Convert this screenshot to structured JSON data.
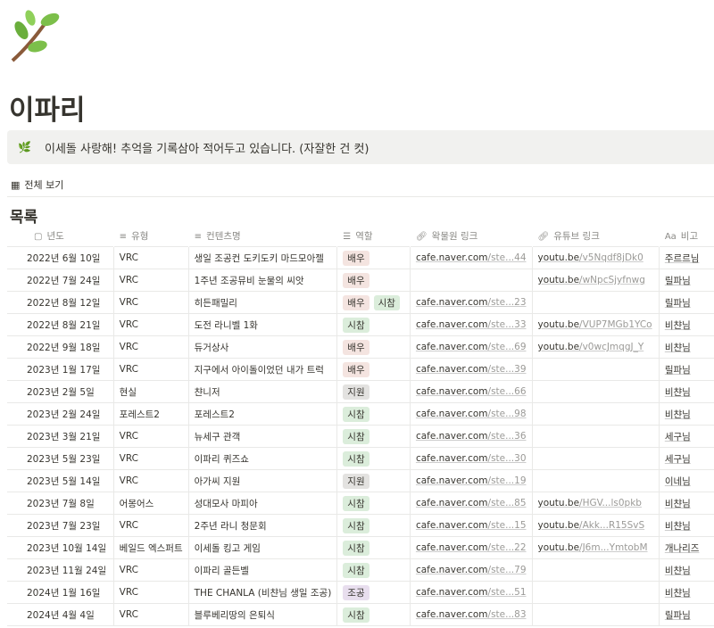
{
  "page": {
    "title": "이파리",
    "callout_icon": "leaf-icon",
    "callout": "이세돌 사랑해! 추억을 기록삼아 적어두고 있습니다. (자잘한 건 컷)",
    "view_label": "전체 보기",
    "section_title": "목록"
  },
  "columns": [
    "년도",
    "유형",
    "컨텐츠명",
    "역할",
    "왁물원 링크",
    "유튜브 링크",
    "비고"
  ],
  "tag_colors": {
    "배우": "#f4e4e0",
    "시참": "#dbeddb",
    "지원": "#e3e2e0",
    "조공": "#e8deee"
  },
  "rows": [
    {
      "date": "2022년 6월 10일",
      "type": "VRC",
      "name": "생일 조공컨 도키도키 마드모아젤",
      "roles": [
        "배우"
      ],
      "cafe": "cafe.naver.com",
      "cafe_rest": "/ste...44",
      "yt": "youtu.be",
      "yt_rest": "/v5Nqdf8jDk0",
      "note": "주르르님"
    },
    {
      "date": "2022년 7월 24일",
      "type": "VRC",
      "name": "1주년 조공뮤비 눈물의 씨앗",
      "roles": [
        "배우"
      ],
      "cafe": "",
      "cafe_rest": "",
      "yt": "youtu.be",
      "yt_rest": "/wNpcSjyfnwg",
      "note": "릴파님"
    },
    {
      "date": "2022년 8월 12일",
      "type": "VRC",
      "name": "히든패밀리",
      "roles": [
        "배우",
        "시참"
      ],
      "cafe": "cafe.naver.com",
      "cafe_rest": "/ste...23",
      "yt": "",
      "yt_rest": "",
      "note": "릴파님"
    },
    {
      "date": "2022년 8월 21일",
      "type": "VRC",
      "name": "도전 라니벨 1화",
      "roles": [
        "시참"
      ],
      "cafe": "cafe.naver.com",
      "cafe_rest": "/ste...33",
      "yt": "youtu.be",
      "yt_rest": "/VUP7MGb1YCo",
      "note": "비챤님"
    },
    {
      "date": "2022년 9월 18일",
      "type": "VRC",
      "name": "듀거상사",
      "roles": [
        "배우"
      ],
      "cafe": "cafe.naver.com",
      "cafe_rest": "/ste...69",
      "yt": "youtu.be",
      "yt_rest": "/v0wcJmqgJ_Y",
      "note": "비챤님"
    },
    {
      "date": "2023년 1월 17일",
      "type": "VRC",
      "name": "지구에서 아이돌이었던 내가 트럭",
      "roles": [
        "배우"
      ],
      "cafe": "cafe.naver.com",
      "cafe_rest": "/ste...39",
      "yt": "",
      "yt_rest": "",
      "note": "릴파님"
    },
    {
      "date": "2023년 2월 5일",
      "type": "현실",
      "name": "챤니저",
      "roles": [
        "지원"
      ],
      "cafe": "cafe.naver.com",
      "cafe_rest": "/ste...66",
      "yt": "",
      "yt_rest": "",
      "note": "비챤님"
    },
    {
      "date": "2023년 2월 24일",
      "type": "포레스트2",
      "name": "포레스트2",
      "roles": [
        "시참"
      ],
      "cafe": "cafe.naver.com",
      "cafe_rest": "/ste...98",
      "yt": "",
      "yt_rest": "",
      "note": "비챤님"
    },
    {
      "date": "2023년 3월 21일",
      "type": "VRC",
      "name": "뉴세구 관객",
      "roles": [
        "시참"
      ],
      "cafe": "cafe.naver.com",
      "cafe_rest": "/ste...36",
      "yt": "",
      "yt_rest": "",
      "note": "세구님"
    },
    {
      "date": "2023년 5월 23일",
      "type": "VRC",
      "name": "이파리 퀴즈쇼",
      "roles": [
        "시참"
      ],
      "cafe": "cafe.naver.com",
      "cafe_rest": "/ste...30",
      "yt": "",
      "yt_rest": "",
      "note": "세구님"
    },
    {
      "date": "2023년 5월 14일",
      "type": "VRC",
      "name": "아가씨 지원",
      "roles": [
        "지원"
      ],
      "cafe": "cafe.naver.com",
      "cafe_rest": "/ste...19",
      "yt": "",
      "yt_rest": "",
      "note": "이네님"
    },
    {
      "date": "2023년 7월 8일",
      "type": "어몽어스",
      "name": "성대모사 마피아",
      "roles": [
        "시참"
      ],
      "cafe": "cafe.naver.com",
      "cafe_rest": "/ste...85",
      "yt": "youtu.be",
      "yt_rest": "/HGV...ls0pkb",
      "note": "비챤님"
    },
    {
      "date": "2023년 7월 23일",
      "type": "VRC",
      "name": "2주년 라니 청문회",
      "roles": [
        "시참"
      ],
      "cafe": "cafe.naver.com",
      "cafe_rest": "/ste...15",
      "yt": "youtu.be",
      "yt_rest": "/Akk...R15SvS",
      "note": "비챤님"
    },
    {
      "date": "2023년 10월 14일",
      "type": "베일드 엑스퍼트",
      "name": "이세돌 킹고 게임",
      "roles": [
        "시참"
      ],
      "cafe": "cafe.naver.com",
      "cafe_rest": "/ste...22",
      "yt": "youtu.be",
      "yt_rest": "/J6m...YmtobM",
      "note": "개나리즈"
    },
    {
      "date": "2023년 11월 24일",
      "type": "VRC",
      "name": "이파리 골든벨",
      "roles": [
        "시참"
      ],
      "cafe": "cafe.naver.com",
      "cafe_rest": "/ste...79",
      "yt": "",
      "yt_rest": "",
      "note": "비챤님"
    },
    {
      "date": "2024년 1월 16일",
      "type": "VRC",
      "name": "THE CHANLA (비챤님 생일 조공)",
      "roles": [
        "조공"
      ],
      "cafe": "cafe.naver.com",
      "cafe_rest": "/ste...51",
      "yt": "",
      "yt_rest": "",
      "note": "비챤님"
    },
    {
      "date": "2024년 4월 4일",
      "type": "VRC",
      "name": "블루베리땅의 은퇴식",
      "roles": [
        "시참"
      ],
      "cafe": "cafe.naver.com",
      "cafe_rest": "/ste...83",
      "yt": "",
      "yt_rest": "",
      "note": "릴파님"
    }
  ]
}
